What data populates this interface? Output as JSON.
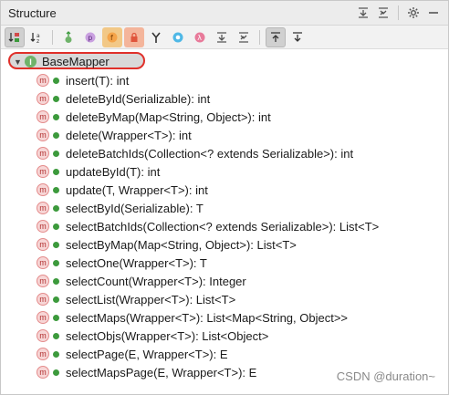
{
  "window": {
    "title": "Structure"
  },
  "title_actions": [
    {
      "icon": "expand-all-icon"
    },
    {
      "icon": "collapse-all-icon"
    },
    {
      "icon": "gear-icon"
    },
    {
      "icon": "hide-panel-icon"
    }
  ],
  "toolbar": [
    {
      "icon": "sort-by-visibility-icon",
      "active": true
    },
    {
      "icon": "sort-alphabetically-icon",
      "active": false
    },
    {
      "icon": "show-inherited-icon",
      "active": false
    },
    {
      "icon": "show-properties-icon",
      "active": false
    },
    {
      "icon": "show-fields-icon",
      "active": true
    },
    {
      "icon": "show-non-public-icon",
      "active": true
    },
    {
      "icon": "show-anonymous-icon",
      "active": false
    },
    {
      "icon": "show-lambdas-icon",
      "active": false
    },
    {
      "icon": "show-lambda-expressions-icon",
      "active": false
    },
    {
      "icon": "expand-all-icon",
      "active": false
    },
    {
      "icon": "collapse-all-icon",
      "active": false
    },
    {
      "icon": "autoscroll-to-source-icon",
      "active": true
    },
    {
      "icon": "autoscroll-from-source-icon",
      "active": false
    }
  ],
  "tree": {
    "root": {
      "label": "BaseMapper",
      "badge": "I",
      "expanded": true
    },
    "methods": [
      {
        "badge": "m",
        "label": "insert(T): int"
      },
      {
        "badge": "m",
        "label": "deleteById(Serializable): int"
      },
      {
        "badge": "m",
        "label": "deleteByMap(Map<String, Object>): int"
      },
      {
        "badge": "m",
        "label": "delete(Wrapper<T>): int"
      },
      {
        "badge": "m",
        "label": "deleteBatchIds(Collection<? extends Serializable>): int"
      },
      {
        "badge": "m",
        "label": "updateById(T): int"
      },
      {
        "badge": "m",
        "label": "update(T, Wrapper<T>): int"
      },
      {
        "badge": "m",
        "label": "selectById(Serializable): T"
      },
      {
        "badge": "m",
        "label": "selectBatchIds(Collection<? extends Serializable>): List<T>"
      },
      {
        "badge": "m",
        "label": "selectByMap(Map<String, Object>): List<T>"
      },
      {
        "badge": "m",
        "label": "selectOne(Wrapper<T>): T"
      },
      {
        "badge": "m",
        "label": "selectCount(Wrapper<T>): Integer"
      },
      {
        "badge": "m",
        "label": "selectList(Wrapper<T>): List<T>"
      },
      {
        "badge": "m",
        "label": "selectMaps(Wrapper<T>): List<Map<String, Object>>"
      },
      {
        "badge": "m",
        "label": "selectObjs(Wrapper<T>): List<Object>"
      },
      {
        "badge": "m",
        "label": "selectPage(E, Wrapper<T>): E"
      },
      {
        "badge": "m",
        "label": "selectMapsPage(E, Wrapper<T>): E"
      }
    ]
  },
  "watermark": "CSDN @duration~",
  "colors": {
    "method_badge": "#e48b8b",
    "interface_badge": "#6fb36a",
    "public_dot": "#3c9a3c",
    "highlight_outline": "#e0302a"
  }
}
